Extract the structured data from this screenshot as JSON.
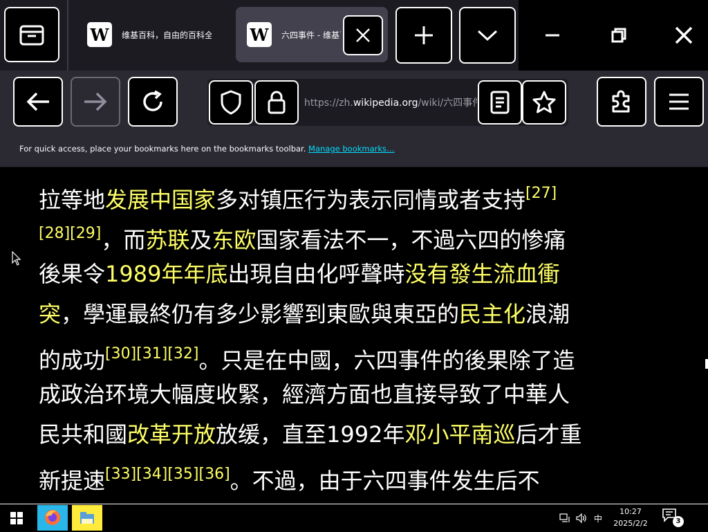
{
  "tabs": [
    {
      "title": "维基百科，自由的百科全书",
      "favicon": "W"
    },
    {
      "title": "六四事件 - 维基百科",
      "favicon": "W"
    }
  ],
  "address": {
    "prefix": "https://zh.",
    "domain": "wikipedia.org",
    "path": "/wiki/六四事件"
  },
  "bookmarks_bar": {
    "message": "For quick access, place your bookmarks here on the bookmarks toolbar.",
    "link": "Manage bookmarks…"
  },
  "article": {
    "lines": [
      [
        {
          "t": "拉等地"
        },
        {
          "t": "发展中国家",
          "k": "link"
        },
        {
          "t": "多对镇压行为表示同情或者支持"
        },
        {
          "t": "[27]",
          "k": "ref"
        }
      ],
      [
        {
          "t": "[28][29]",
          "k": "ref"
        },
        {
          "t": "，而"
        },
        {
          "t": "苏联",
          "k": "link"
        },
        {
          "t": "及"
        },
        {
          "t": "东欧",
          "k": "link"
        },
        {
          "t": "国家看法不一，不過六四的惨痛"
        }
      ],
      [
        {
          "t": "後果令"
        },
        {
          "t": "1989年年底",
          "k": "link"
        },
        {
          "t": "出現自由化呼聲時"
        },
        {
          "t": "没有發生流血衝",
          "k": "link"
        }
      ],
      [
        {
          "t": "突",
          "k": "link"
        },
        {
          "t": "，學運最終仍有多少影響到東歐與東亞的"
        },
        {
          "t": "民主化",
          "k": "link"
        },
        {
          "t": "浪潮"
        }
      ],
      [
        {
          "t": "的成功"
        },
        {
          "t": "[30][31][32]",
          "k": "ref"
        },
        {
          "t": "。只是在中國，六四事件的後果除了造"
        }
      ],
      [
        {
          "t": "成政治环境大幅度收緊，經濟方面也直接导致了中華人"
        }
      ],
      [
        {
          "t": "民共和國"
        },
        {
          "t": "改革开放",
          "k": "link"
        },
        {
          "t": "放缓，直至1992年"
        },
        {
          "t": "邓小平南巡",
          "k": "link"
        },
        {
          "t": "后才重"
        }
      ],
      [
        {
          "t": "新提速"
        },
        {
          "t": "[33][34][35][36]",
          "k": "ref"
        },
        {
          "t": "。不過，由于六四事件发生后不"
        }
      ]
    ]
  },
  "taskbar": {
    "ime": "中",
    "time": "10:27",
    "date": "2025/2/2",
    "notifications": "3"
  },
  "colors": {
    "link": "#ffff66",
    "text": "#ffffff",
    "background": "#000000"
  }
}
